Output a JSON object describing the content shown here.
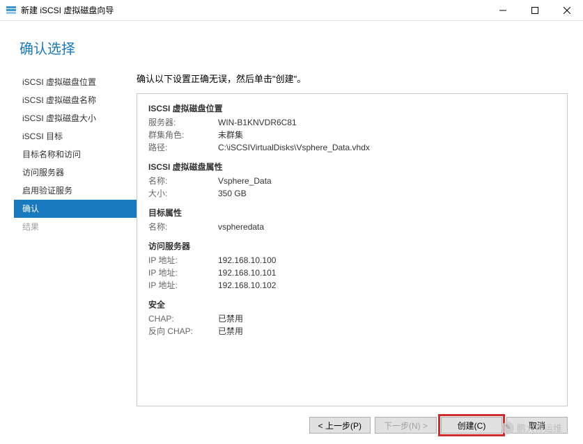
{
  "window": {
    "title": "新建 iSCSI 虚拟磁盘向导"
  },
  "page": {
    "title": "确认选择",
    "instruction": "确认以下设置正确无误，然后单击\"创建\"。"
  },
  "sidebar": {
    "items": [
      {
        "label": "iSCSI 虚拟磁盘位置",
        "state": "normal"
      },
      {
        "label": "iSCSI 虚拟磁盘名称",
        "state": "normal"
      },
      {
        "label": "iSCSI 虚拟磁盘大小",
        "state": "normal"
      },
      {
        "label": "iSCSI 目标",
        "state": "normal"
      },
      {
        "label": "目标名称和访问",
        "state": "normal"
      },
      {
        "label": "访问服务器",
        "state": "normal"
      },
      {
        "label": "启用验证服务",
        "state": "normal"
      },
      {
        "label": "确认",
        "state": "selected"
      },
      {
        "label": "结果",
        "state": "disabled"
      }
    ]
  },
  "summary": {
    "location": {
      "title": "ISCSI 虚拟磁盘位置",
      "server_label": "服务器:",
      "server_value": "WIN-B1KNVDR6C81",
      "cluster_label": "群集角色:",
      "cluster_value": "未群集",
      "path_label": "路径:",
      "path_value": "C:\\iSCSIVirtualDisks\\Vsphere_Data.vhdx"
    },
    "props": {
      "title": "ISCSI 虚拟磁盘属性",
      "name_label": "名称:",
      "name_value": "Vsphere_Data",
      "size_label": "大小:",
      "size_value": "350 GB"
    },
    "target": {
      "title": "目标属性",
      "name_label": "名称:",
      "name_value": "vspheredata"
    },
    "access": {
      "title": "访问服务器",
      "ip_label": "IP 地址:",
      "ips": [
        "192.168.10.100",
        "192.168.10.101",
        "192.168.10.102"
      ]
    },
    "security": {
      "title": "安全",
      "chap_label": "CHAP:",
      "chap_value": "已禁用",
      "rchap_label": "反向 CHAP:",
      "rchap_value": "已禁用"
    }
  },
  "footer": {
    "prev": "< 上一步(P)",
    "next": "下一步(N) >",
    "create": "创建(C)",
    "cancel": "取消"
  },
  "watermark": "鹏大师运维"
}
